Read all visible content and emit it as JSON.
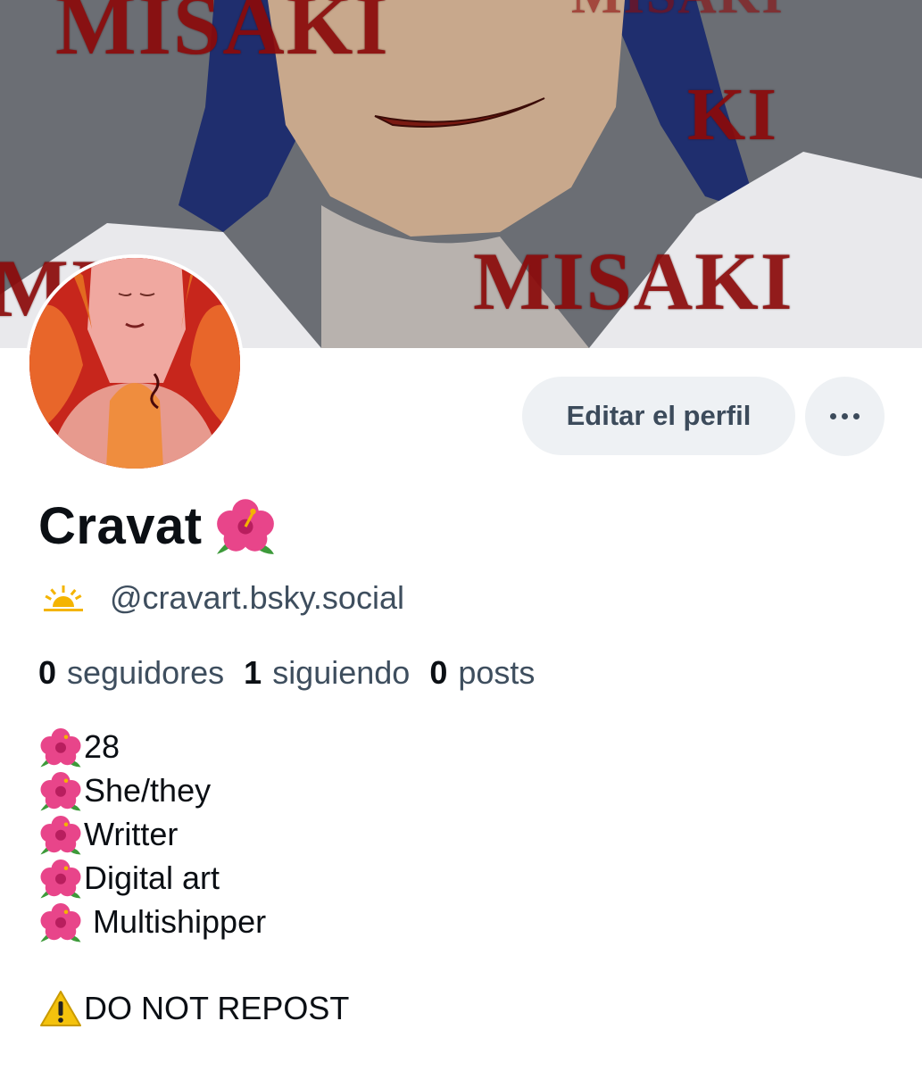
{
  "banner": {
    "words": [
      "MISAKI",
      "MISAKI",
      "KI",
      "MISAKI",
      "MI"
    ]
  },
  "profile": {
    "display_name": "Cravat",
    "handle": "@cravart.bsky.social",
    "name_emoji": "hibiscus-icon",
    "handle_icon": "sunrise-icon"
  },
  "actions": {
    "edit_label": "Editar el perfil",
    "more_icon": "more-icon"
  },
  "stats": [
    {
      "count": "0",
      "label": "seguidores"
    },
    {
      "count": "1",
      "label": "siguiendo"
    },
    {
      "count": "0",
      "label": "posts"
    }
  ],
  "bio": {
    "lines": [
      "28",
      "She/they",
      "Writter",
      "Digital art",
      "Multishipper"
    ],
    "warning": "DO NOT REPOST",
    "line_icon": "hibiscus-icon",
    "warning_icon": "warning-icon"
  },
  "colors": {
    "primary_text": "#0b0f14",
    "secondary_text": "#3e4e5e",
    "button_bg": "#eef1f4",
    "banner_text": "#8b0a0a"
  }
}
